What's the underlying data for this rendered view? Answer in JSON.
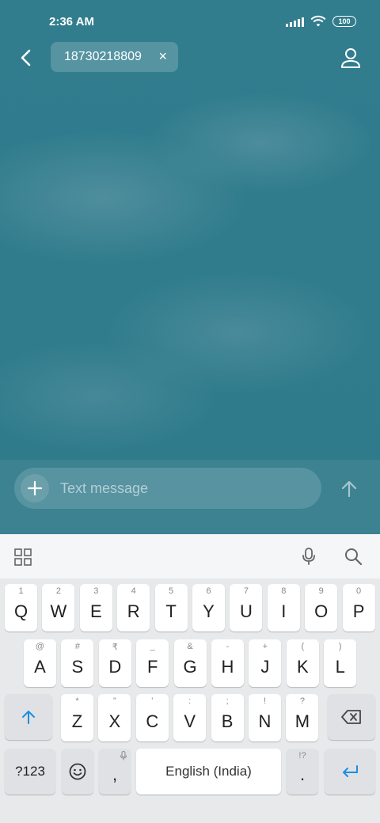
{
  "status_bar": {
    "time": "2:36 AM",
    "battery": "100"
  },
  "header": {
    "recipient": "18730218809",
    "chip_close": "×",
    "back_icon": "chevron-left-icon",
    "contact_icon": "person-icon"
  },
  "compose": {
    "placeholder": "Text message",
    "value": ""
  },
  "keyboard": {
    "row1": [
      {
        "key": "Q",
        "hint": "1"
      },
      {
        "key": "W",
        "hint": "2"
      },
      {
        "key": "E",
        "hint": "3"
      },
      {
        "key": "R",
        "hint": "4"
      },
      {
        "key": "T",
        "hint": "5"
      },
      {
        "key": "Y",
        "hint": "6"
      },
      {
        "key": "U",
        "hint": "7"
      },
      {
        "key": "I",
        "hint": "8"
      },
      {
        "key": "O",
        "hint": "9"
      },
      {
        "key": "P",
        "hint": "0"
      }
    ],
    "row2": [
      {
        "key": "A",
        "hint": "@"
      },
      {
        "key": "S",
        "hint": "#"
      },
      {
        "key": "D",
        "hint": "₹"
      },
      {
        "key": "F",
        "hint": "_"
      },
      {
        "key": "G",
        "hint": "&"
      },
      {
        "key": "H",
        "hint": "-"
      },
      {
        "key": "J",
        "hint": "+"
      },
      {
        "key": "K",
        "hint": "("
      },
      {
        "key": "L",
        "hint": ")"
      }
    ],
    "row3": [
      {
        "key": "Z",
        "hint": "*"
      },
      {
        "key": "X",
        "hint": "\""
      },
      {
        "key": "C",
        "hint": "'"
      },
      {
        "key": "V",
        "hint": ":"
      },
      {
        "key": "B",
        "hint": ";"
      },
      {
        "key": "N",
        "hint": "!"
      },
      {
        "key": "M",
        "hint": "?"
      }
    ],
    "symbols_label": "?123",
    "comma": ",",
    "space_label": "English (India)",
    "period": ".",
    "period_hint": "!?",
    "accent_color": "#1a8fe0"
  }
}
